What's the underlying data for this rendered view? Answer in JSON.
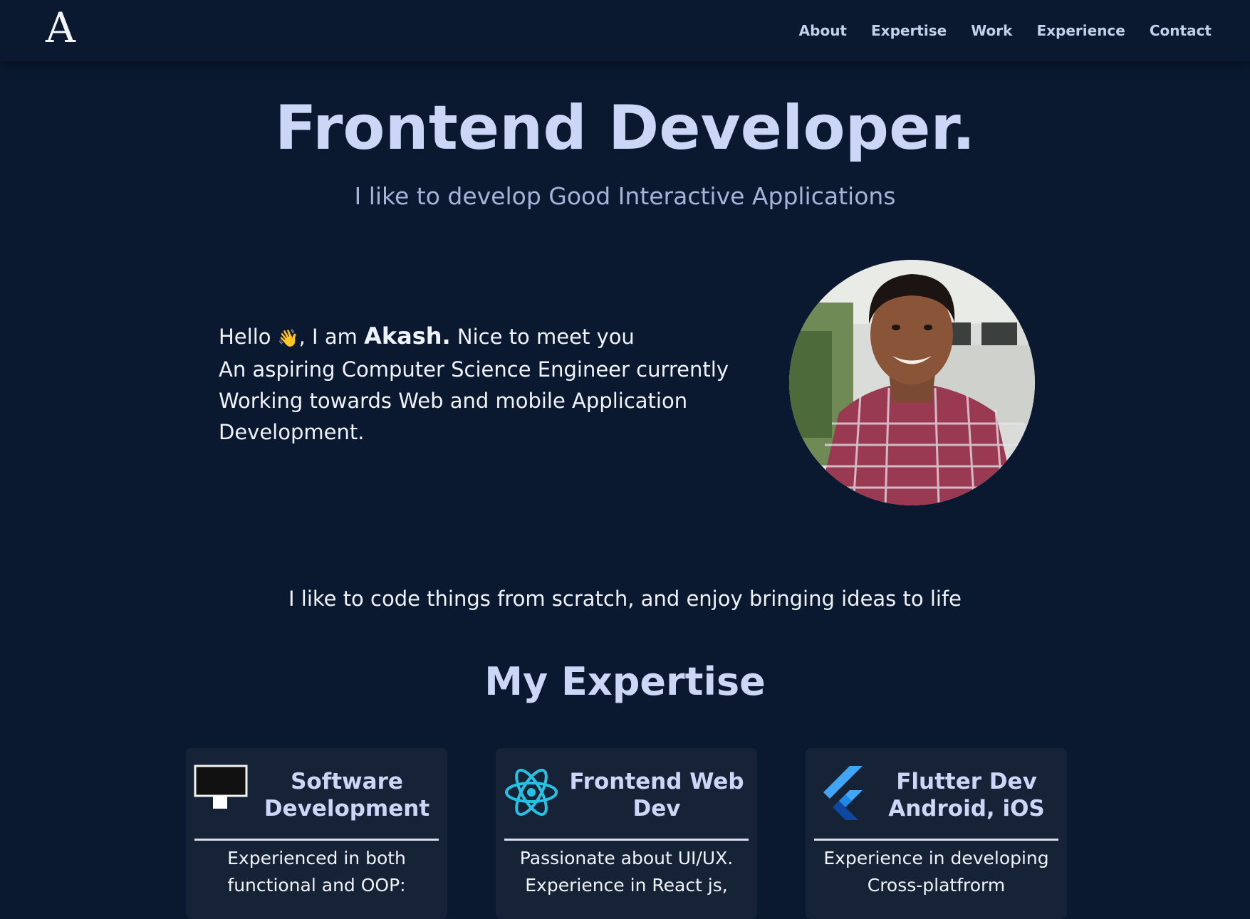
{
  "nav": {
    "logo": "A",
    "links": [
      "About",
      "Expertise",
      "Work",
      "Experience",
      "Contact"
    ]
  },
  "hero": {
    "title": "Frontend Developer.",
    "subtitle": "I like to develop Good Interactive Applications"
  },
  "intro": {
    "hello": "Hello",
    "wave": "👋",
    "iam": ", I am",
    "name": "Akash.",
    "nice": "Nice to meet you",
    "line2": "An aspiring Computer Science Engineer currently",
    "line3": "Working towards Web and mobile Application",
    "line4": "Development."
  },
  "tagline": "I like to code things from scratch, and enjoy bringing ideas to life",
  "expertise": {
    "title": "My Expertise",
    "cards": [
      {
        "icon": "monitor-icon",
        "title_line1": "Software",
        "title_line2": "Development",
        "body_line1": "Experienced in both",
        "body_line2": "functional and OOP:"
      },
      {
        "icon": "react-icon",
        "title_line1": "Frontend Web",
        "title_line2": "Dev",
        "body_line1": "Passionate about UI/UX.",
        "body_line2": "Experience in React js,"
      },
      {
        "icon": "flutter-icon",
        "title_line1": "Flutter Dev",
        "title_line2": "Android, iOS",
        "body_line1": "Experience in developing",
        "body_line2": "Cross-platfrorm"
      }
    ]
  },
  "colors": {
    "background": "#0a1930",
    "card": "#162337",
    "heading": "#ccd6f6",
    "react": "#25c2e6",
    "flutter": "#42a5f5"
  }
}
